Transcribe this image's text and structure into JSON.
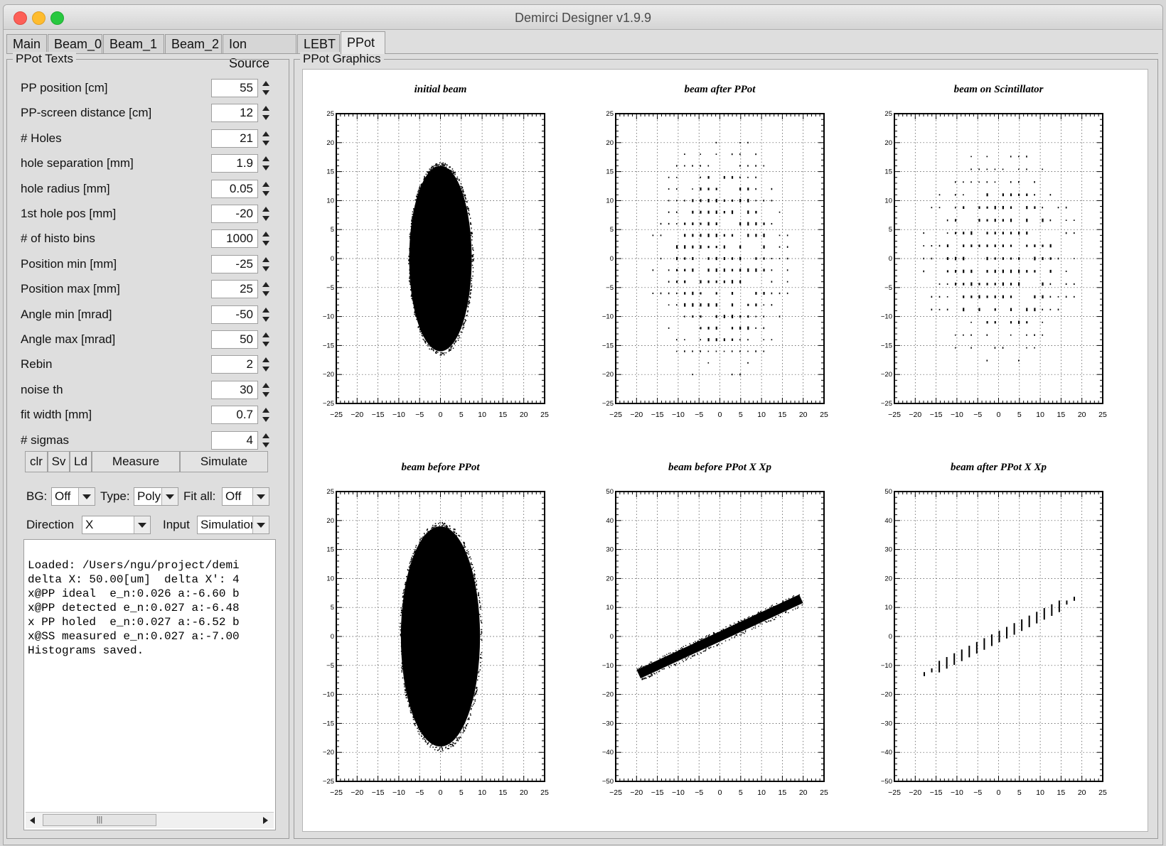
{
  "window": {
    "title": "Demirci Designer v1.9.9"
  },
  "tabs": [
    "Main",
    "Beam_0",
    "Beam_1",
    "Beam_2",
    "Ion Source",
    "LEBT",
    "PPot"
  ],
  "left_panel": {
    "group_title": "PPot Texts",
    "params": [
      {
        "label": "PP position [cm]",
        "value": "55"
      },
      {
        "label": "PP-screen distance  [cm]",
        "value": "12"
      },
      {
        "label": "# Holes",
        "value": "21"
      },
      {
        "label": "hole separation [mm]",
        "value": "1.9"
      },
      {
        "label": "hole radius [mm]",
        "value": "0.05"
      },
      {
        "label": "1st hole pos [mm]",
        "value": "-20"
      },
      {
        "label": "# of histo bins",
        "value": "1000"
      },
      {
        "label": "Position min [mm]",
        "value": "-25"
      },
      {
        "label": "Position max [mm]",
        "value": "25"
      },
      {
        "label": "Angle min [mrad]",
        "value": "-50"
      },
      {
        "label": "Angle max [mrad]",
        "value": "50"
      },
      {
        "label": "Rebin",
        "value": "2"
      },
      {
        "label": "noise th",
        "value": "30"
      },
      {
        "label": "fit width [mm]",
        "value": "0.7"
      },
      {
        "label": "# sigmas",
        "value": "4"
      }
    ],
    "buttons": {
      "clr": "clr",
      "sv": "Sv",
      "ld": "Ld",
      "measure": "Measure",
      "simulate": "Simulate"
    },
    "bg": {
      "label": "BG:",
      "value": "Off"
    },
    "type": {
      "label": "Type:",
      "value": "Poly"
    },
    "fitall": {
      "label": "Fit all:",
      "value": "Off"
    },
    "direction": {
      "label": "Direction",
      "value": "X"
    },
    "input": {
      "label": "Input",
      "value": "Simulation"
    },
    "log": [
      "Loaded: /Users/ngu/project/demi",
      "delta X: 50.00[um]  delta X': 4",
      "x@PP ideal  e_n:0.026 a:-6.60 b",
      "x@PP detected e_n:0.027 a:-6.48",
      "x PP holed  e_n:0.027 a:-6.52 b",
      "x@SS measured e_n:0.027 a:-7.00",
      "Histograms saved."
    ]
  },
  "graphics": {
    "group_title": "PPot Graphics",
    "plots": [
      {
        "title": "initial beam",
        "xticks": [
          "−25",
          "−20",
          "−15",
          "−10",
          "−5",
          "0",
          "5",
          "10",
          "15",
          "20",
          "25"
        ],
        "yticks": [
          "25",
          "20",
          "15",
          "10",
          "5",
          "0",
          "−5",
          "−10",
          "−15",
          "−20",
          "−25"
        ]
      },
      {
        "title": "beam after PPot",
        "xticks": [
          "−25",
          "−20",
          "−15",
          "−10",
          "−5",
          "0",
          "5",
          "10",
          "15",
          "20",
          "25"
        ],
        "yticks": [
          "25",
          "20",
          "15",
          "10",
          "5",
          "0",
          "−5",
          "−10",
          "−15",
          "−20",
          "−25"
        ]
      },
      {
        "title": "beam on Scintillator",
        "xticks": [
          "−25",
          "−20",
          "−15",
          "−10",
          "−5",
          "0",
          "5",
          "10",
          "15",
          "20",
          "25"
        ],
        "yticks": [
          "25",
          "20",
          "15",
          "10",
          "5",
          "0",
          "−5",
          "−10",
          "−15",
          "−20",
          "−25"
        ]
      },
      {
        "title": "beam before PPot",
        "xticks": [
          "−25",
          "−20",
          "−15",
          "−10",
          "−5",
          "0",
          "5",
          "10",
          "15",
          "20",
          "25"
        ],
        "yticks": [
          "25",
          "20",
          "15",
          "10",
          "5",
          "0",
          "−5",
          "−10",
          "−15",
          "−20",
          "−25"
        ]
      },
      {
        "title": "beam before PPot X Xp",
        "xticks": [
          "−25",
          "−20",
          "−15",
          "−10",
          "−5",
          "0",
          "5",
          "10",
          "15",
          "20",
          "25"
        ],
        "yticks": [
          "50",
          "40",
          "30",
          "20",
          "10",
          "0",
          "−10",
          "−20",
          "−30",
          "−40",
          "−50"
        ]
      },
      {
        "title": "beam after PPot X Xp",
        "xticks": [
          "−25",
          "−20",
          "−15",
          "−10",
          "−5",
          "0",
          "5",
          "10",
          "15",
          "20",
          "25"
        ],
        "yticks": [
          "50",
          "40",
          "30",
          "20",
          "10",
          "0",
          "−10",
          "−20",
          "−30",
          "−40",
          "−50"
        ]
      }
    ]
  },
  "chart_data": [
    {
      "type": "scatter",
      "title": "initial beam",
      "xlim": [
        -25,
        25
      ],
      "ylim": [
        -25,
        25
      ],
      "grid": true,
      "shape": "ellipse",
      "center": [
        0,
        0
      ],
      "semi_axes": [
        7.5,
        16
      ]
    },
    {
      "type": "scatter",
      "title": "beam after PPot",
      "xlim": [
        -25,
        25
      ],
      "ylim": [
        -25,
        25
      ],
      "grid": true,
      "shape": "hole-grid",
      "center": [
        0,
        0
      ],
      "semi_axes": [
        17,
        22
      ],
      "hole_spacing": [
        1.9,
        2
      ]
    },
    {
      "type": "scatter",
      "title": "beam on Scintillator",
      "xlim": [
        -25,
        25
      ],
      "ylim": [
        -25,
        25
      ],
      "grid": true,
      "shape": "hole-grid",
      "center": [
        0,
        0
      ],
      "semi_axes": [
        19.5,
        19
      ],
      "hole_spacing": [
        1.9,
        2.2
      ]
    },
    {
      "type": "scatter",
      "title": "beam before PPot",
      "xlim": [
        -25,
        25
      ],
      "ylim": [
        -25,
        25
      ],
      "grid": true,
      "shape": "ellipse",
      "center": [
        0,
        0
      ],
      "semi_axes": [
        9.5,
        19
      ]
    },
    {
      "type": "scatter",
      "title": "beam before PPot X Xp",
      "xlim": [
        -25,
        25
      ],
      "ylim": [
        -50,
        50
      ],
      "grid": true,
      "shape": "band",
      "from": [
        -19.5,
        -13
      ],
      "to": [
        19.5,
        13
      ],
      "half_width": 1.6
    },
    {
      "type": "scatter",
      "title": "beam after PPot X Xp",
      "xlim": [
        -25,
        25
      ],
      "ylim": [
        -50,
        50
      ],
      "grid": true,
      "shape": "segments",
      "from": [
        -18,
        -13
      ],
      "to": [
        18,
        13
      ],
      "segment_length": 4
    }
  ]
}
